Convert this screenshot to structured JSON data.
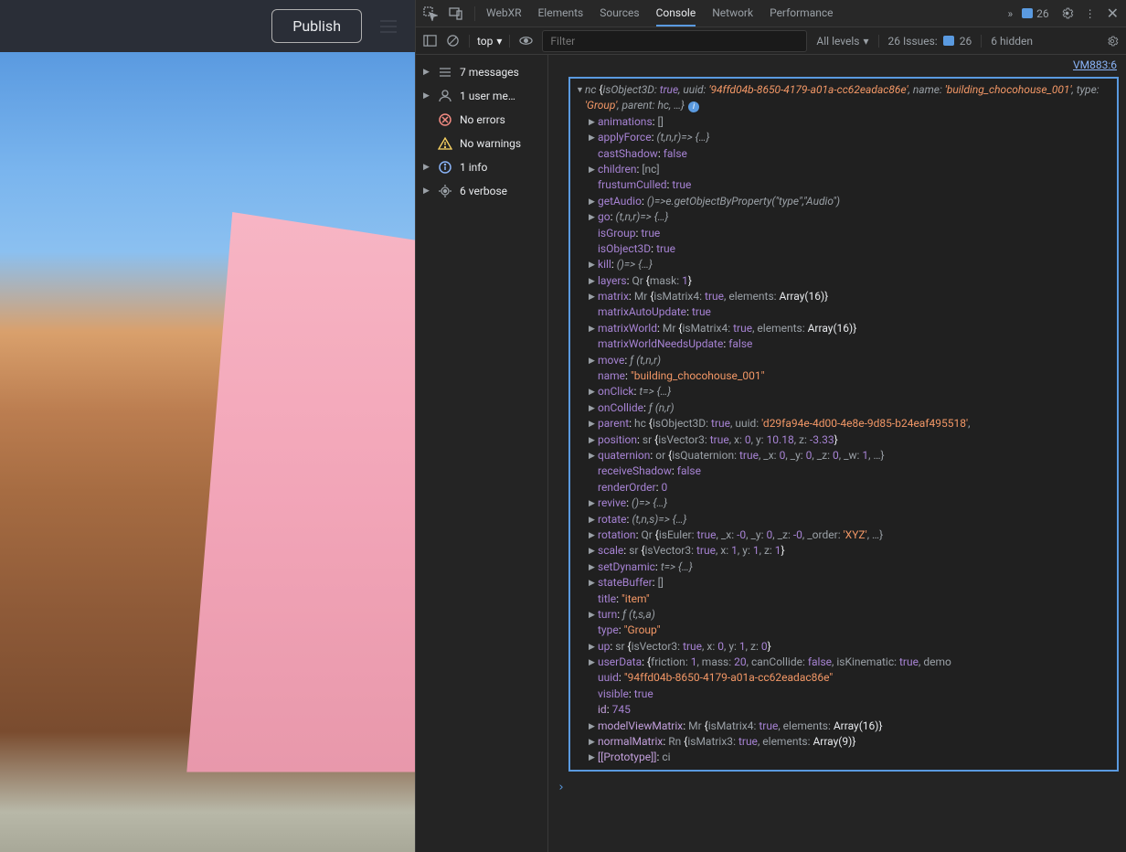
{
  "leftPanel": {
    "publish": "Publish"
  },
  "tabs": {
    "items": [
      "WebXR",
      "Elements",
      "Sources",
      "Console",
      "Network",
      "Performance"
    ],
    "activeIndex": 3,
    "msgCount": "26"
  },
  "filterbar": {
    "topLabel": "top",
    "placeholder": "Filter",
    "levels": "All levels",
    "issuesLabel": "26 Issues:",
    "issuesCount": "26",
    "hidden": "6 hidden"
  },
  "sidebar": {
    "items": [
      {
        "tri": true,
        "icon": "msg",
        "label": "7 messages"
      },
      {
        "tri": true,
        "icon": "user",
        "label": "1 user me…"
      },
      {
        "tri": false,
        "icon": "err",
        "label": "No errors"
      },
      {
        "tri": false,
        "icon": "warn",
        "label": "No warnings"
      },
      {
        "tri": true,
        "icon": "info",
        "label": "1 info"
      },
      {
        "tri": true,
        "icon": "verbose",
        "label": "6 verbose"
      }
    ]
  },
  "vmLink": "VM883:6",
  "objHeader": {
    "cls": "nc",
    "p1": "isObject3D",
    "v1": "true",
    "p2": "uuid",
    "v2": "'94ffd04b-8650-4179-a01a-cc62eadac86e'",
    "p3": "name",
    "v3": "'building_chocohouse_001'",
    "p4": "type",
    "v4": "'Group'",
    "p5": "parent",
    "v5": "hc"
  },
  "props": [
    {
      "tri": true,
      "k": "animations",
      "raw": "[]"
    },
    {
      "tri": true,
      "k": "applyForce",
      "fn": "(t,n,r)=> {…}"
    },
    {
      "tri": false,
      "k": "castShadow",
      "bool": "false"
    },
    {
      "tri": true,
      "k": "children",
      "raw": "[nc]"
    },
    {
      "tri": false,
      "k": "frustumCulled",
      "bool": "true"
    },
    {
      "tri": true,
      "k": "getAudio",
      "fn": "()=>e.getObjectByProperty(\"type\",\"Audio\")"
    },
    {
      "tri": true,
      "k": "go",
      "fn": "(t,n,r)=> {…}"
    },
    {
      "tri": false,
      "k": "isGroup",
      "bool": "true"
    },
    {
      "tri": false,
      "k": "isObject3D",
      "bool": "true"
    },
    {
      "tri": true,
      "k": "kill",
      "fn": "()=> {…}"
    },
    {
      "tri": true,
      "k": "layers",
      "complex": "layers"
    },
    {
      "tri": true,
      "k": "matrix",
      "complex": "matrix"
    },
    {
      "tri": false,
      "k": "matrixAutoUpdate",
      "bool": "true"
    },
    {
      "tri": true,
      "k": "matrixWorld",
      "complex": "matrixWorld"
    },
    {
      "tri": false,
      "k": "matrixWorldNeedsUpdate",
      "bool": "false"
    },
    {
      "tri": true,
      "k": "move",
      "fsig": "ƒ (t,n,r)"
    },
    {
      "tri": false,
      "k": "name",
      "str": "\"building_chocohouse_001\""
    },
    {
      "tri": true,
      "k": "onClick",
      "fn": "t=> {…}"
    },
    {
      "tri": true,
      "k": "onCollide",
      "fsig": "ƒ (n,r)"
    },
    {
      "tri": true,
      "k": "parent",
      "complex": "parent"
    },
    {
      "tri": true,
      "k": "position",
      "complex": "position"
    },
    {
      "tri": true,
      "k": "quaternion",
      "complex": "quaternion"
    },
    {
      "tri": false,
      "k": "receiveShadow",
      "bool": "false"
    },
    {
      "tri": false,
      "k": "renderOrder",
      "num": "0"
    },
    {
      "tri": true,
      "k": "revive",
      "fn": "()=> {…}"
    },
    {
      "tri": true,
      "k": "rotate",
      "fn": "(t,n,s)=> {…}"
    },
    {
      "tri": true,
      "k": "rotation",
      "complex": "rotation"
    },
    {
      "tri": true,
      "k": "scale",
      "complex": "scale"
    },
    {
      "tri": true,
      "k": "setDynamic",
      "fn": "t=> {…}"
    },
    {
      "tri": true,
      "k": "stateBuffer",
      "raw": "[]"
    },
    {
      "tri": false,
      "k": "title",
      "str": "\"item\""
    },
    {
      "tri": true,
      "k": "turn",
      "fsig": "ƒ (t,s,a)"
    },
    {
      "tri": false,
      "k": "type",
      "str": "\"Group\""
    },
    {
      "tri": true,
      "k": "up",
      "complex": "up"
    },
    {
      "tri": true,
      "k": "userData",
      "complex": "userData"
    },
    {
      "tri": false,
      "k": "uuid",
      "str": "\"94ffd04b-8650-4179-a01a-cc62eadac86e\""
    },
    {
      "tri": false,
      "k": "visible",
      "bool": "true"
    },
    {
      "tri": false,
      "k": "id",
      "num": "745",
      "noBold": true
    },
    {
      "tri": true,
      "k": "modelViewMatrix",
      "complex": "modelViewMatrix",
      "dim": true
    },
    {
      "tri": true,
      "k": "normalMatrix",
      "complex": "normalMatrix",
      "dim": true
    },
    {
      "tri": true,
      "k": "[[Prototype]]",
      "raw": "ci",
      "dim": true
    }
  ],
  "complex": {
    "layers": [
      [
        "Qr ",
        "gray"
      ],
      [
        "{",
        "white"
      ],
      [
        "mask",
        "gray"
      ],
      [
        ": ",
        "gray"
      ],
      [
        "1",
        "num"
      ],
      [
        "}",
        "white"
      ]
    ],
    "matrix": [
      [
        "Mr ",
        "gray"
      ],
      [
        "{",
        "white"
      ],
      [
        "isMatrix4",
        "gray"
      ],
      [
        ": ",
        "gray"
      ],
      [
        "true",
        "bool"
      ],
      [
        ", ",
        "gray"
      ],
      [
        "elements",
        "gray"
      ],
      [
        ": ",
        "gray"
      ],
      [
        "Array(16)",
        "white"
      ],
      [
        "}",
        "white"
      ]
    ],
    "matrixWorld": [
      [
        "Mr ",
        "gray"
      ],
      [
        "{",
        "white"
      ],
      [
        "isMatrix4",
        "gray"
      ],
      [
        ": ",
        "gray"
      ],
      [
        "true",
        "bool"
      ],
      [
        ", ",
        "gray"
      ],
      [
        "elements",
        "gray"
      ],
      [
        ": ",
        "gray"
      ],
      [
        "Array(16)",
        "white"
      ],
      [
        "}",
        "white"
      ]
    ],
    "parent": [
      [
        "hc ",
        "gray"
      ],
      [
        "{",
        "white"
      ],
      [
        "isObject3D",
        "gray"
      ],
      [
        ": ",
        "gray"
      ],
      [
        "true",
        "bool"
      ],
      [
        ", ",
        "gray"
      ],
      [
        "uuid",
        "gray"
      ],
      [
        ": ",
        "gray"
      ],
      [
        "'d29fa94e-4d00-4e8e-9d85-b24eaf495518'",
        "str"
      ],
      [
        ",",
        "gray"
      ]
    ],
    "position": [
      [
        "sr ",
        "gray"
      ],
      [
        "{",
        "white"
      ],
      [
        "isVector3",
        "gray"
      ],
      [
        ": ",
        "gray"
      ],
      [
        "true",
        "bool"
      ],
      [
        ", ",
        "gray"
      ],
      [
        "x",
        "gray"
      ],
      [
        ": ",
        "gray"
      ],
      [
        "0",
        "num"
      ],
      [
        ", ",
        "gray"
      ],
      [
        "y",
        "gray"
      ],
      [
        ": ",
        "gray"
      ],
      [
        "10.18",
        "num"
      ],
      [
        ", ",
        "gray"
      ],
      [
        "z",
        "gray"
      ],
      [
        ": ",
        "gray"
      ],
      [
        "-3.33",
        "num"
      ],
      [
        "}",
        "white"
      ]
    ],
    "quaternion": [
      [
        "or ",
        "gray"
      ],
      [
        "{",
        "white"
      ],
      [
        "isQuaternion",
        "gray"
      ],
      [
        ": ",
        "gray"
      ],
      [
        "true",
        "bool"
      ],
      [
        ", ",
        "gray"
      ],
      [
        "_x",
        "gray"
      ],
      [
        ": ",
        "gray"
      ],
      [
        "0",
        "num"
      ],
      [
        ", ",
        "gray"
      ],
      [
        "_y",
        "gray"
      ],
      [
        ": ",
        "gray"
      ],
      [
        "0",
        "num"
      ],
      [
        ", ",
        "gray"
      ],
      [
        "_z",
        "gray"
      ],
      [
        ": ",
        "gray"
      ],
      [
        "0",
        "num"
      ],
      [
        ", ",
        "gray"
      ],
      [
        "_w",
        "gray"
      ],
      [
        ": ",
        "gray"
      ],
      [
        "1",
        "num"
      ],
      [
        ", …}",
        "gray"
      ]
    ],
    "rotation": [
      [
        "Qr ",
        "gray"
      ],
      [
        "{",
        "white"
      ],
      [
        "isEuler",
        "gray"
      ],
      [
        ": ",
        "gray"
      ],
      [
        "true",
        "bool"
      ],
      [
        ", ",
        "gray"
      ],
      [
        "_x",
        "gray"
      ],
      [
        ": ",
        "gray"
      ],
      [
        "-0",
        "num"
      ],
      [
        ", ",
        "gray"
      ],
      [
        "_y",
        "gray"
      ],
      [
        ": ",
        "gray"
      ],
      [
        "0",
        "num"
      ],
      [
        ", ",
        "gray"
      ],
      [
        "_z",
        "gray"
      ],
      [
        ": ",
        "gray"
      ],
      [
        "-0",
        "num"
      ],
      [
        ", ",
        "gray"
      ],
      [
        "_order",
        "gray"
      ],
      [
        ": ",
        "gray"
      ],
      [
        "'XYZ'",
        "str"
      ],
      [
        ", …}",
        "gray"
      ]
    ],
    "scale": [
      [
        "sr ",
        "gray"
      ],
      [
        "{",
        "white"
      ],
      [
        "isVector3",
        "gray"
      ],
      [
        ": ",
        "gray"
      ],
      [
        "true",
        "bool"
      ],
      [
        ", ",
        "gray"
      ],
      [
        "x",
        "gray"
      ],
      [
        ": ",
        "gray"
      ],
      [
        "1",
        "num"
      ],
      [
        ", ",
        "gray"
      ],
      [
        "y",
        "gray"
      ],
      [
        ": ",
        "gray"
      ],
      [
        "1",
        "num"
      ],
      [
        ", ",
        "gray"
      ],
      [
        "z",
        "gray"
      ],
      [
        ": ",
        "gray"
      ],
      [
        "1",
        "num"
      ],
      [
        "}",
        "white"
      ]
    ],
    "up": [
      [
        "sr ",
        "gray"
      ],
      [
        "{",
        "white"
      ],
      [
        "isVector3",
        "gray"
      ],
      [
        ": ",
        "gray"
      ],
      [
        "true",
        "bool"
      ],
      [
        ", ",
        "gray"
      ],
      [
        "x",
        "gray"
      ],
      [
        ": ",
        "gray"
      ],
      [
        "0",
        "num"
      ],
      [
        ", ",
        "gray"
      ],
      [
        "y",
        "gray"
      ],
      [
        ": ",
        "gray"
      ],
      [
        "1",
        "num"
      ],
      [
        ", ",
        "gray"
      ],
      [
        "z",
        "gray"
      ],
      [
        ": ",
        "gray"
      ],
      [
        "0",
        "num"
      ],
      [
        "}",
        "white"
      ]
    ],
    "userData": [
      [
        "{",
        "white"
      ],
      [
        "friction",
        "gray"
      ],
      [
        ": ",
        "gray"
      ],
      [
        "1",
        "num"
      ],
      [
        ", ",
        "gray"
      ],
      [
        "mass",
        "gray"
      ],
      [
        ": ",
        "gray"
      ],
      [
        "20",
        "num"
      ],
      [
        ", ",
        "gray"
      ],
      [
        "canCollide",
        "gray"
      ],
      [
        ": ",
        "gray"
      ],
      [
        "false",
        "bool"
      ],
      [
        ", ",
        "gray"
      ],
      [
        "isKinematic",
        "gray"
      ],
      [
        ": ",
        "gray"
      ],
      [
        "true",
        "bool"
      ],
      [
        ", ",
        "gray"
      ],
      [
        "demo",
        "gray"
      ]
    ],
    "modelViewMatrix": [
      [
        "Mr ",
        "gray"
      ],
      [
        "{",
        "white"
      ],
      [
        "isMatrix4",
        "gray"
      ],
      [
        ": ",
        "gray"
      ],
      [
        "true",
        "bool"
      ],
      [
        ", ",
        "gray"
      ],
      [
        "elements",
        "gray"
      ],
      [
        ": ",
        "gray"
      ],
      [
        "Array(16)",
        "white"
      ],
      [
        "}",
        "white"
      ]
    ],
    "normalMatrix": [
      [
        "Rn ",
        "gray"
      ],
      [
        "{",
        "white"
      ],
      [
        "isMatrix3",
        "gray"
      ],
      [
        ": ",
        "gray"
      ],
      [
        "true",
        "bool"
      ],
      [
        ", ",
        "gray"
      ],
      [
        "elements",
        "gray"
      ],
      [
        ": ",
        "gray"
      ],
      [
        "Array(9)",
        "white"
      ],
      [
        "}",
        "white"
      ]
    ]
  },
  "promptChar": "›"
}
